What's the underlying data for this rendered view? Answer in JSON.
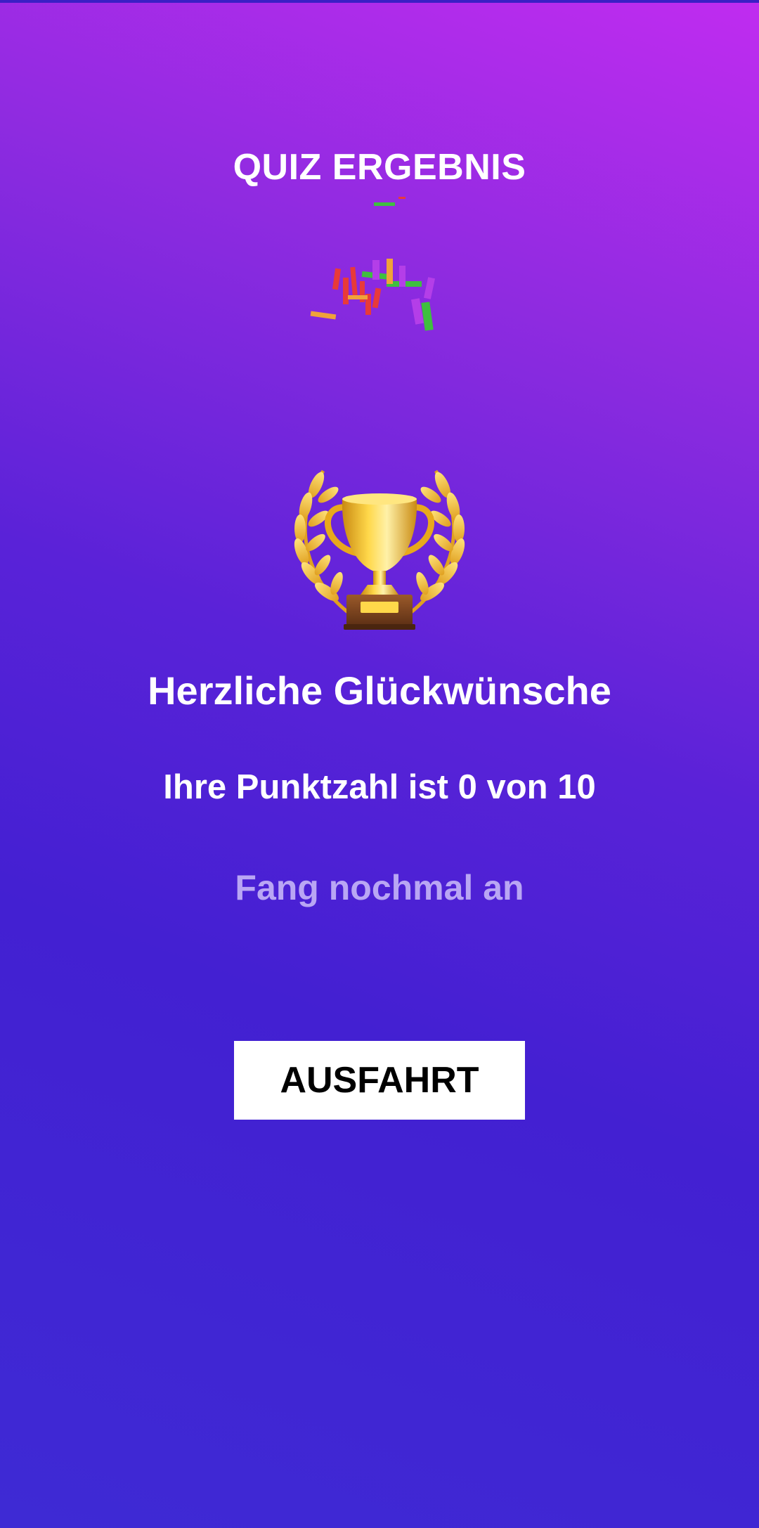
{
  "header": {
    "title": "QUIZ ERGEBNIS"
  },
  "result": {
    "trophy_icon": "trophy-icon",
    "congrats_text": "Herzliche Glückwünsche",
    "score_text": "Ihre Punktzahl ist 0 von 10",
    "retry_text": "Fang nochmal an"
  },
  "actions": {
    "exit_label": "AUSFAHRT"
  },
  "colors": {
    "gradient_top": "#c02cf0",
    "gradient_bottom": "#3e2ad4",
    "retry_text": "#b9a6f4",
    "button_bg": "#ffffff"
  }
}
